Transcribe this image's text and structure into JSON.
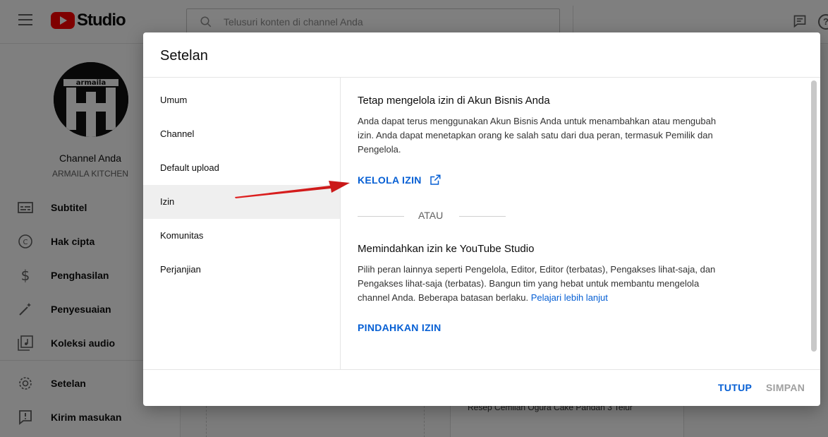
{
  "app": {
    "logo_text": "Studio",
    "search_placeholder": "Telusuri konten di channel Anda",
    "help_label": "?"
  },
  "sidebar": {
    "channel_title": "Channel Anda",
    "channel_name": "ARMAILA KITCHEN",
    "avatar_text": "armaila",
    "items": [
      {
        "label": "Subtitel",
        "icon": "subtitles-icon"
      },
      {
        "label": "Hak cipta",
        "icon": "copyright-icon"
      },
      {
        "label": "Penghasilan",
        "icon": "dollar-icon"
      },
      {
        "label": "Penyesuaian",
        "icon": "magic-wand-icon"
      },
      {
        "label": "Koleksi audio",
        "icon": "audio-library-icon"
      },
      {
        "label": "Setelan",
        "icon": "gear-icon"
      },
      {
        "label": "Kirim masukan",
        "icon": "feedback-icon"
      }
    ]
  },
  "background": {
    "video_title_snippet": "Resep Cemilan Ogura Cake Pandan 3 Telur"
  },
  "dialog": {
    "title": "Setelan",
    "nav": [
      "Umum",
      "Channel",
      "Default upload",
      "Izin",
      "Komunitas",
      "Perjanjian"
    ],
    "active_nav": "Izin",
    "section1": {
      "title": "Tetap mengelola izin di Akun Bisnis Anda",
      "text": "Anda dapat terus menggunakan Akun Bisnis Anda untuk menambahkan atau mengubah izin. Anda dapat menetapkan orang ke salah satu dari dua peran, termasuk Pemilik dan Pengelola.",
      "link": "KELOLA IZIN"
    },
    "or_label": "ATAU",
    "section2": {
      "title": "Memindahkan izin ke YouTube Studio",
      "text": "Pilih peran lainnya seperti Pengelola, Editor, Editor (terbatas), Pengakses lihat-saja, dan Pengakses lihat-saja (terbatas). Bangun tim yang hebat untuk membantu mengelola channel Anda. Beberapa batasan berlaku.",
      "learn_more": "Pelajari lebih lanjut",
      "link": "PINDAHKAN IZIN"
    },
    "footer": {
      "close": "TUTUP",
      "save": "SIMPAN"
    }
  },
  "colors": {
    "accent": "#065fd4",
    "brand_red": "#ff0000",
    "annotation_arrow": "#e02020"
  }
}
